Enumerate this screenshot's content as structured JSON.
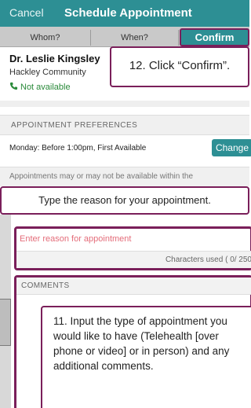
{
  "nav": {
    "cancel_label": "Cancel",
    "title": "Schedule Appointment"
  },
  "tabs": [
    {
      "label": "Whom?"
    },
    {
      "label": "When?"
    },
    {
      "label": "Confirm"
    }
  ],
  "doctor": {
    "name": "Dr. Leslie Kingsley",
    "location": "Hackley Community",
    "availability": "Not available"
  },
  "callouts": {
    "step12": "12. Click “Confirm”.",
    "banner": "Type the reason for your appointment.",
    "step11": "11. Input the type of appointment you would like to have (Telehealth [over phone or video] or in person) and any additional comments."
  },
  "preferences": {
    "header": "APPOINTMENT PREFERENCES",
    "value": "Monday: Before 1:00pm, First Available",
    "change_label": "Change"
  },
  "disclaimer": "Appointments may or may not be available within the",
  "reason": {
    "placeholder": "Enter reason for appointment",
    "char_count": "Characters used ( 0/ 250"
  },
  "comments": {
    "header": "COMMENTS"
  },
  "colors": {
    "accent": "#2d8f94",
    "highlight": "#7a1f5a",
    "available": "#2a8a3a",
    "placeholder": "#e46d7a"
  }
}
